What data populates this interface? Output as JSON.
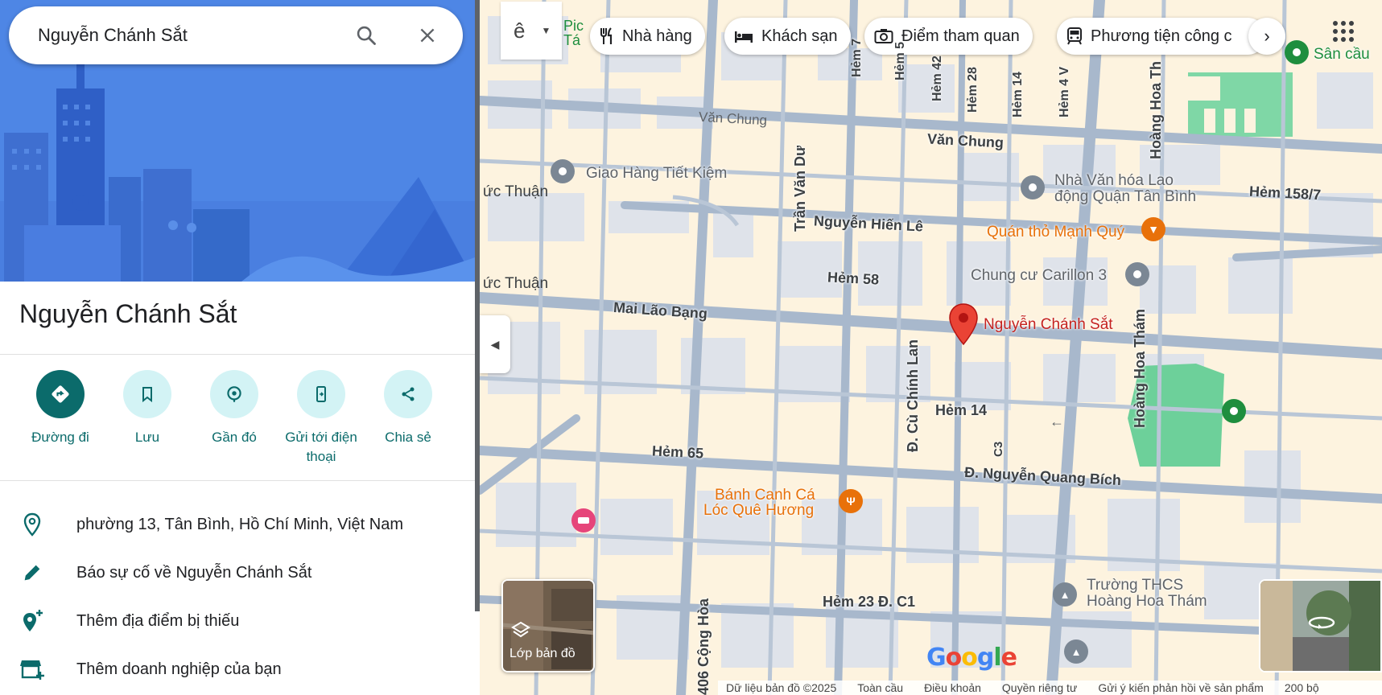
{
  "search": {
    "value": "Nguyễn Chánh Sắt"
  },
  "place": {
    "title": "Nguyễn Chánh Sắt"
  },
  "actions": [
    {
      "label": "Đường đi"
    },
    {
      "label": "Lưu"
    },
    {
      "label": "Gần đó"
    },
    {
      "label": "Gửi tới điện thoại"
    },
    {
      "label": "Chia sẻ"
    }
  ],
  "info": [
    {
      "text": "phường 13, Tân Bình, Hồ Chí Minh, Việt Nam",
      "icon": "location-pin-icon"
    },
    {
      "text": "Báo sự cố về Nguyễn Chánh Sắt",
      "icon": "pencil-icon"
    },
    {
      "text": "Thêm địa điểm bị thiếu",
      "icon": "add-location-icon"
    },
    {
      "text": "Thêm doanh nghiệp của bạn",
      "icon": "add-business-icon"
    }
  ],
  "chips": [
    {
      "label": "Nhà hàng",
      "icon": "restaurant-icon"
    },
    {
      "label": "Khách sạn",
      "icon": "hotel-icon"
    },
    {
      "label": "Điểm tham quan",
      "icon": "camera-icon"
    },
    {
      "label": "Phương tiện công c",
      "icon": "transit-icon"
    }
  ],
  "map": {
    "mode_glyph": "ê",
    "roads": {
      "van_chung": "Văn Chung",
      "van_chung_small": "Văn Chung",
      "nguyen_hien_le": "Nguyễn Hiến Lê",
      "hem_58": "Hẻm 58",
      "mai_lao_bang": "Mai Lão Bạng",
      "hem_14": "Hẻm 14",
      "hem_65": "Hẻm 65",
      "nguyen_quang_bich": "Đ. Nguyễn Quang Bích",
      "hem_23": "Hẻm 23 Đ. C1",
      "hem_158": "Hẻm 158/7",
      "tran_van_du": "Trần Văn Dư",
      "cu_chinh_lan": "Đ. Cù Chính Lan",
      "hoang_hoa_tham": "Hoàng Hoa Thám",
      "hoang_hoa_tham_2": "Hoàng Hoa Th",
      "cong_hoa": "406 Cộng Hòa",
      "c3": "C3",
      "hem_7": "Hẻm 7",
      "hem_5": "Hẻm 5",
      "hem_42": "Hẻm 42",
      "hem_28": "Hẻm 28",
      "hem_14v": "Hẻm 14",
      "hem_4": "Hẻm 4 V",
      "duc_thuan_1": "ức Thuận",
      "duc_thuan_2": "ức Thuận",
      "pic": "Pic",
      "ta": "Tá"
    },
    "pois": {
      "giao_hang": "Giao Hàng Tiết Kiệm",
      "nha_van_hoa_1": "Nhà Văn hóa Lao",
      "nha_van_hoa_2": "động Quận Tân Bình",
      "quan_tho": "Quán thỏ Mạnh Quý",
      "chung_cu": "Chung cư Carillon 3",
      "selected": "Nguyễn Chánh Sắt",
      "banh_canh_1": "Bánh Canh Cá",
      "banh_canh_2": "Lóc Quê Hương",
      "truong_1": "Trường THCS",
      "truong_2": "Hoàng Hoa Thám",
      "san": "Sân cầu"
    },
    "layers_label": "Lớp bản đồ",
    "google": "Google",
    "footer": {
      "data": "Dữ liệu bản đồ ©2025",
      "global": "Toàn cầu",
      "terms": "Điều khoản",
      "privacy": "Quyền riêng tư",
      "feedback": "Gửi ý kiến phản hồi về sản phẩm",
      "scale": "200 bộ"
    }
  },
  "colors": {
    "accent": "#0b6b6b",
    "action_bg": "#d3f3f5",
    "hero": "#4e86e5",
    "marker": "#ea4335",
    "map_bg": "#fdf3df",
    "road": "#a8b8cc",
    "poi_orange": "#e8710a",
    "poi_gray": "#7b8794",
    "park": "#6dd09a"
  }
}
